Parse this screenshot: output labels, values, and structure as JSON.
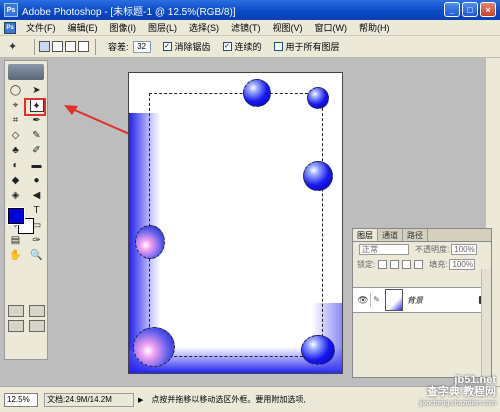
{
  "window": {
    "logo_text": "Ps",
    "title": "Adobe Photoshop - [未标题-1 @ 12.5%(RGB/8)]",
    "minimize": "_",
    "maximize": "□",
    "close": "×"
  },
  "menubar": {
    "logo_text": "Ps",
    "items": [
      "文件(F)",
      "编辑(E)",
      "图像(I)",
      "图层(L)",
      "选择(S)",
      "滤镜(T)",
      "视图(V)",
      "窗口(W)",
      "帮助(H)"
    ]
  },
  "options": {
    "tool_icon": "magic-wand-icon",
    "tool_glyph": "✦",
    "tolerance_label": "容差:",
    "tolerance_value": "32",
    "antialias_label": "消除锯齿",
    "antialias_checked": true,
    "contiguous_label": "连续的",
    "contiguous_checked": true,
    "all_layers_label": "用于所有图层",
    "all_layers_checked": false
  },
  "toolbox": {
    "rows": [
      [
        "◯",
        "➤"
      ],
      [
        "⌖",
        "✦"
      ],
      [
        "⌗",
        "✒"
      ],
      [
        "◇",
        "✎"
      ],
      [
        "♣",
        "✐"
      ],
      [
        "◐",
        "▬"
      ],
      [
        "◆",
        "●"
      ],
      [
        "◈",
        "◀"
      ],
      [
        "↖",
        "T"
      ],
      [
        "✧",
        "▭"
      ],
      [
        "▤",
        "✑"
      ],
      [
        "✋",
        "🔍"
      ]
    ],
    "foreground_color": "#0000e0",
    "background_color": "#ffffff"
  },
  "layers_panel": {
    "tabs": [
      "图层",
      "通道",
      "路径"
    ],
    "blend_mode": "正常",
    "opacity_label": "不透明度:",
    "opacity_value": "100%",
    "lock_label": "锁定:",
    "fill_label": "填充:",
    "fill_value": "100%",
    "layer_name": "背景"
  },
  "statusbar": {
    "zoom": "12.5%",
    "doc_info": "文档:24.9M/14.2M",
    "hint": "点按并拖移以移动选区外框。要用附加选项,"
  },
  "watermark": {
    "line1": "查字典 教程网",
    "line2": "jiaocheng.chazidian.com",
    "site": "jb51.net"
  },
  "colors": {
    "accent": "#0000e0",
    "highlight": "#e03028"
  }
}
